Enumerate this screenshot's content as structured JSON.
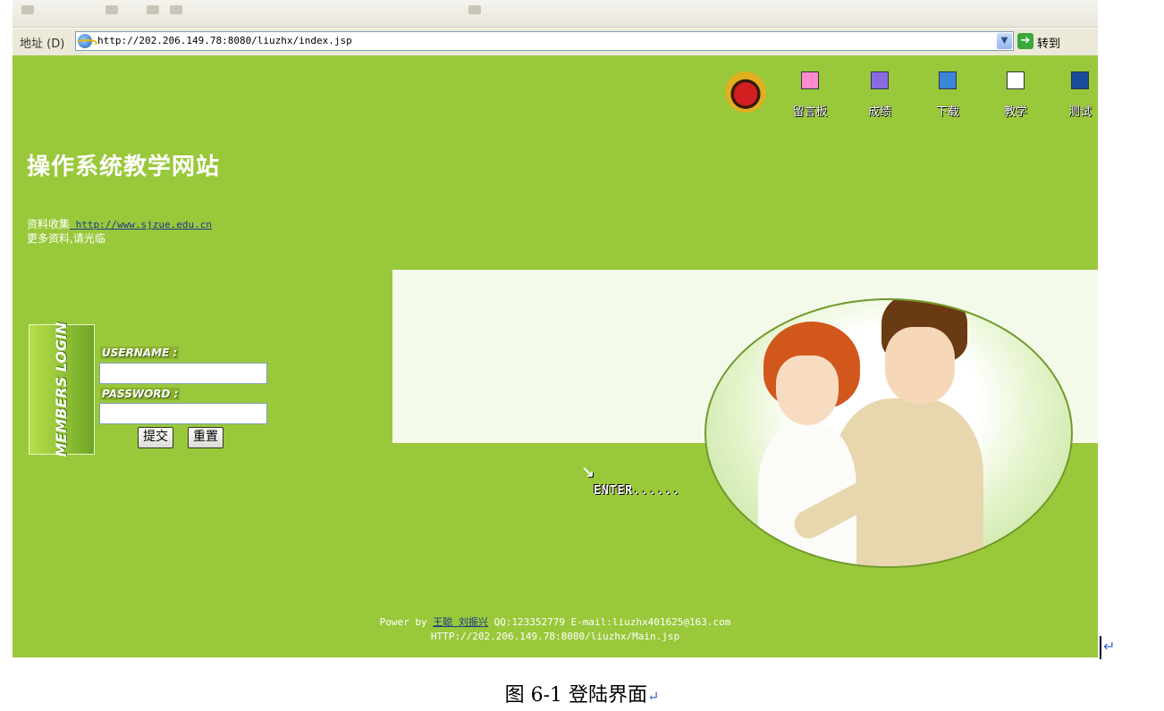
{
  "browser": {
    "address_label": "地址 (D)",
    "url": "http://202.206.149.78:8080/liuzhx/index.jsp",
    "go_label": "转到"
  },
  "nav": {
    "items": [
      {
        "label": "留言板",
        "icon": "guestbook-icon",
        "color": "#ff8ad0"
      },
      {
        "label": "成绩",
        "icon": "grades-icon",
        "color": "#8a6ae0"
      },
      {
        "label": "下载",
        "icon": "download-icon",
        "color": "#3a86d8"
      },
      {
        "label": "教学",
        "icon": "teaching-icon",
        "color": "#ffffff"
      },
      {
        "label": "测试",
        "icon": "test-icon",
        "color": "#1a4a9a"
      }
    ]
  },
  "site": {
    "title": "操作系统教学网站",
    "info_prefix": "资料收集",
    "info_link": " http://www.sjzue.edu.cn",
    "info_line2": "更多资料,请光临"
  },
  "login": {
    "side_text": "MEMBERS LOGIN",
    "username_label": "USERNAME :",
    "password_label": "PASSWORD :",
    "submit": "提交",
    "reset": "重置"
  },
  "enter": {
    "arrow": "↘",
    "text": "ENTER......"
  },
  "footer": {
    "power_by": "Power by ",
    "authors": "王聪 刘振兴",
    "contact": " QQ:123352779 E-mail:liuzhx401625@163.com",
    "url": "HTTP://202.206.149.78:8080/liuzhx/Main.jsp"
  },
  "caption": {
    "text": "图 6-1 登陆界面",
    "mark": "↵"
  },
  "colors": {
    "page_bg": "#99c83b",
    "banner_bg": "#f4faea"
  }
}
